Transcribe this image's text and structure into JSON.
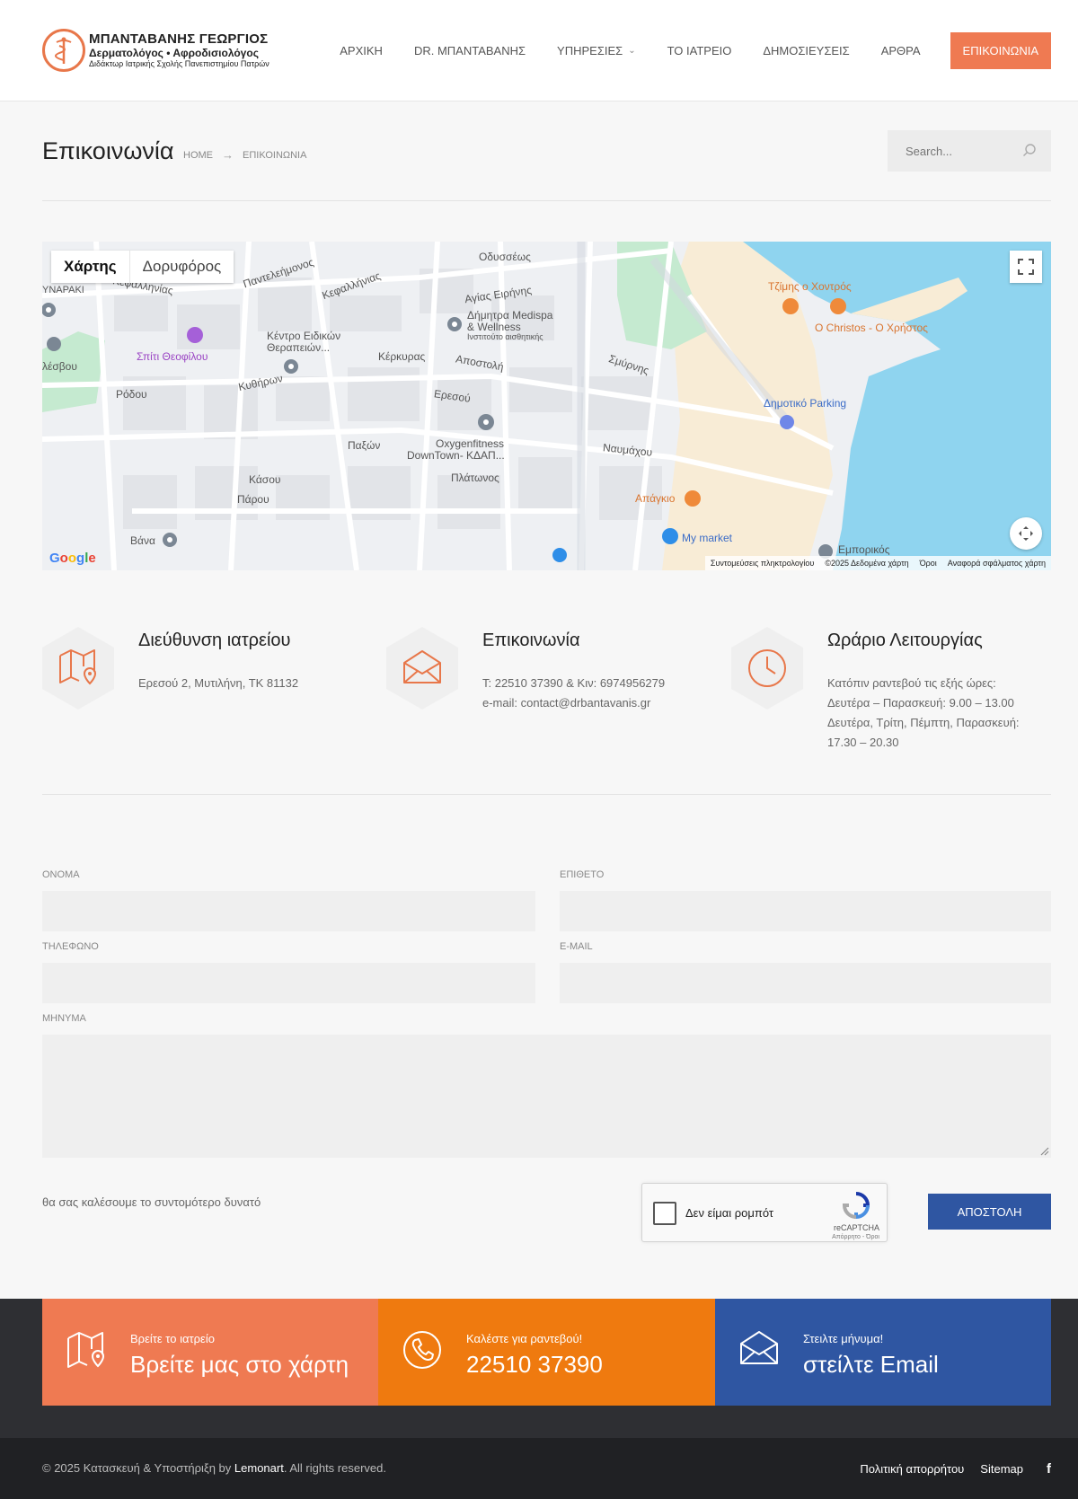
{
  "header": {
    "logo": {
      "line1": "ΜΠΑΝΤΑΒΑΝΗΣ ΓΕΩΡΓΙΟΣ",
      "line2": "Δερματολόγος • Αφροδισιολόγος",
      "line3": "Διδάκτωρ Ιατρικής Σχολής Πανεπιστημίου Πατρών"
    },
    "nav": [
      "ΑΡΧΙΚΗ",
      "DR. ΜΠΑΝΤΑΒΑΝΗΣ",
      "ΥΠΗΡΕΣΙΕΣ",
      "ΤΟ ΙΑΤΡΕΙΟ",
      "ΔΗΜΟΣΙΕΥΣΕΙΣ",
      "ΑΡΘΡΑ",
      "ΕΠΙΚΟΙΝΩΝΙΑ"
    ]
  },
  "page": {
    "title": "Επικοινωνία",
    "breadcrumb": [
      "HOME",
      "ΕΠΙΚΟΙΝΩΝΙΑ"
    ],
    "search_placeholder": "Search..."
  },
  "map": {
    "tabs": [
      "Χάρτης",
      "Δορυφόρος"
    ],
    "google": "Google",
    "footer": [
      "Συντομεύσεις πληκτρολογίου",
      "©2025 Δεδομένα χάρτη",
      "Όροι",
      "Αναφορά σφάλματος χάρτη"
    ],
    "labels": {
      "odysseos": "Οδυσσέως",
      "kefallinias": "Κεφαλληνίας",
      "kefallinias2": "Κεφαλλήνιας",
      "panteleimonos": "Παντελεήμονος",
      "agias_eirinis": "Αγίας Ειρήνης",
      "dimitra": "Δήμητρα Medispa",
      "wellness": "& Wellness",
      "institute": "Ινστιτούτο αισθητικής",
      "kentro": "Κέντρο Ειδικών",
      "therapeion": "Θεραπειών...",
      "spiti": "Σπίτι Θεοφίλου",
      "kerkyras": "Κέρκυρας",
      "apostoli": "Αποστολή",
      "rodou": "Ρόδου",
      "kythiron": "Κυθήρων",
      "eresou": "Ερεσού",
      "smyrnis": "Σμύρνης",
      "paxon": "Παξών",
      "oxygen": "Oxygenfitness",
      "downtown": "DownTown- ΚΔΑΠ...",
      "platonos": "Πλάτωνος",
      "naumaxou": "Ναυμάχου",
      "kasou": "Κάσου",
      "parou": "Πάρου",
      "vana": "Βάνα",
      "tzimis": "Τζίμης ο Χοντρός",
      "christos": "Ο Christos - Ο Χρήστος",
      "parking": "Δημοτικό Parking",
      "apagkio": "Απάγκιο",
      "mymarket": "My market",
      "emporikos": "Εμπορικός",
      "lesvou": "λέσβου",
      "napaki": "ΥΝΑΡΑΚΙ"
    }
  },
  "info": [
    {
      "title": "Διεύθυνση ιατρείου",
      "lines": [
        "Ερεσού 2, Μυτιλήνη, ΤΚ 81132"
      ]
    },
    {
      "title": "Επικοινωνία",
      "lines": [
        "T: 22510 37390 & Κιν: 6974956279",
        "e-mail: contact@drbantavanis.gr"
      ]
    },
    {
      "title": "Ωράριο Λειτουργίας",
      "lines": [
        "Κατόπιν ραντεβού τις εξής ώρες:",
        "Δευτέρα – Παρασκευή: 9.00 – 13.00",
        "Δευτέρα, Τρίτη, Πέμπτη, Παρασκευή:",
        "17.30 – 20.30"
      ]
    }
  ],
  "form": {
    "labels": {
      "name": "ΟΝΟΜΑ",
      "surname": "ΕΠΙΘΕΤΟ",
      "phone": "ΤΗΛΕΦΩΝΟ",
      "email": "E-MAIL",
      "message": "ΜΗΝΥΜΑ"
    },
    "note": "θα σας καλέσουμε το συντομότερο δυνατό",
    "recaptcha": {
      "label": "Δεν είμαι ρομπότ",
      "brand": "reCAPTCHA",
      "sub": "Απόρρητο - Όροι"
    },
    "submit": "ΑΠΟΣΤΟΛΗ"
  },
  "cta": [
    {
      "small": "Βρείτε το ιατρείο",
      "big": "Βρείτε μας στο χάρτη",
      "color": "#ef7a52",
      "icon": "map-icon"
    },
    {
      "small": "Καλέστε για ραντεβού!",
      "big": "22510 37390",
      "color": "#ef7a0f",
      "icon": "phone-icon"
    },
    {
      "small": "Στειλτε μήνυμα!",
      "big": "στείλτε Email",
      "color": "#2f56a2",
      "icon": "envelope-icon"
    }
  ],
  "footer": {
    "copy_prefix": "© 2025 Κατασκευή & Υποστήριξη by ",
    "copy_brand": "Lemonart",
    "copy_suffix": ". All rights reserved.",
    "links": [
      "Πολιτική απορρήτου",
      "Sitemap"
    ]
  },
  "colors": {
    "accent": "#ef7a52",
    "orange": "#ef7a0f",
    "blue": "#2f56a2",
    "dark": "#2e2f33"
  }
}
